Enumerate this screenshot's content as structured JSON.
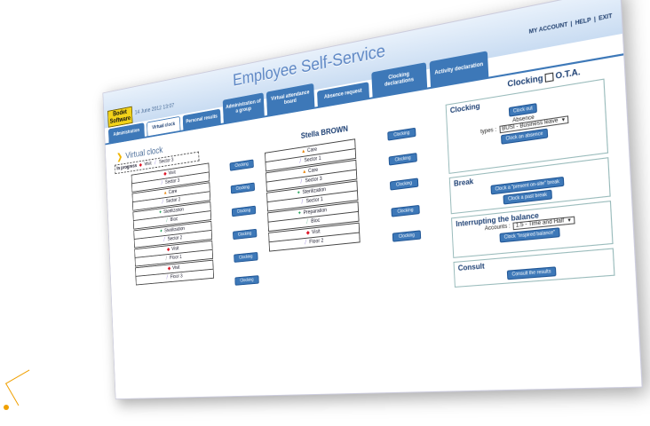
{
  "header": {
    "logo_text": "Bodet Software",
    "date": "14 June 2012 13:07",
    "app_title": "Employee Self-Service",
    "links": [
      "MY ACCOUNT",
      "HELP",
      "EXIT"
    ]
  },
  "tabs": [
    {
      "label": "Administration"
    },
    {
      "label": "Virtual clock"
    },
    {
      "label": "Personal results"
    },
    {
      "label": "Administration of a group"
    },
    {
      "label": "Virtual attendance board"
    },
    {
      "label": "Absence request"
    },
    {
      "label": "Clocking declarations"
    },
    {
      "label": "Activity declaration"
    }
  ],
  "virtual_clock": {
    "title": "Virtual clock",
    "status_label": "In progress",
    "status_visit": "Visit",
    "status_sector": "Sector 3"
  },
  "left_column": [
    {
      "top": {
        "icon": "visit-icon",
        "label": "Visit"
      },
      "bottom": {
        "icon": "sector-icon",
        "label": "Sector 3"
      }
    },
    {
      "top": {
        "icon": "care-icon",
        "label": "Care"
      },
      "bottom": {
        "icon": "sector-icon",
        "label": "Sector 2"
      }
    },
    {
      "top": {
        "icon": "sterilization-icon",
        "label": "Sterilization"
      },
      "bottom": {
        "icon": "bloc-icon",
        "label": "Bloc"
      }
    },
    {
      "top": {
        "icon": "sterilization-icon",
        "label": "Sterilization"
      },
      "bottom": {
        "icon": "sector-icon",
        "label": "Sector 2"
      }
    },
    {
      "top": {
        "icon": "visit-icon",
        "label": "Visit"
      },
      "bottom": {
        "icon": "floor-icon",
        "label": "Floor 1"
      }
    },
    {
      "top": {
        "icon": "visit-icon",
        "label": "Visit"
      },
      "bottom": {
        "icon": "sector-icon",
        "label": "Floor 3"
      }
    }
  ],
  "right_column": [
    {
      "top": {
        "icon": "care-icon",
        "label": "Care"
      },
      "bottom": {
        "icon": "sector-icon",
        "label": "Sector 1"
      }
    },
    {
      "top": {
        "icon": "care-icon",
        "label": "Care"
      },
      "bottom": {
        "icon": "sector-icon",
        "label": "Sector 3"
      }
    },
    {
      "top": {
        "icon": "sterilization-icon",
        "label": "Sterilization"
      },
      "bottom": {
        "icon": "sector-icon",
        "label": "Sector 1"
      }
    },
    {
      "top": {
        "icon": "sterilization-icon",
        "label": "Preparation"
      },
      "bottom": {
        "icon": "bloc-icon",
        "label": "Bloc"
      }
    },
    {
      "top": {
        "icon": "visit-icon",
        "label": "Visit"
      },
      "bottom": {
        "icon": "sector-icon",
        "label": "Floor 2"
      }
    }
  ],
  "clocking_button_label": "Clocking",
  "person_name": "Stella BROWN",
  "ota": {
    "label": "Clocking",
    "suffix": "O.T.A."
  },
  "panels": {
    "clocking": {
      "title": "Clocking",
      "clock_out": "Clock out",
      "absence_label": "Absence",
      "types_label": "types :",
      "types_value": "BUSI - Business leave",
      "clock_absence": "Clock an absence"
    },
    "break": {
      "title": "Break",
      "present_on_site": "Clock a \"present on-site\" break",
      "past_break": "Clock a past break"
    },
    "interrupting": {
      "title": "Interrupting the balance",
      "accounts_label": "Accounts :",
      "accounts_value": "1.5 - Time and Half",
      "clock_balance": "Clock \"Inspired balance\""
    },
    "consult": {
      "title": "Consult",
      "consult_results": "Consult the results"
    }
  }
}
